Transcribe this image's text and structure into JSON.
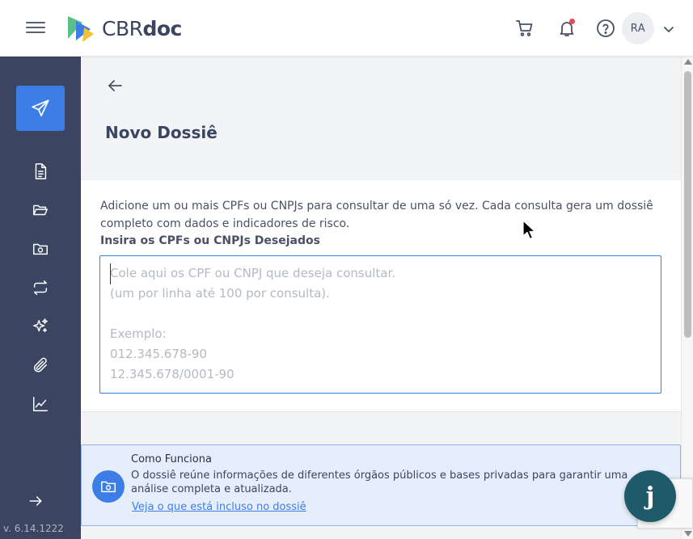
{
  "header": {
    "brand_cbr": "CBR",
    "brand_doc": "doc",
    "avatar_initials": "RA",
    "icons": [
      "menu-icon",
      "cart-icon",
      "bell-icon",
      "help-icon",
      "chevron-down-icon"
    ],
    "notification_dot_color": "#e24b58"
  },
  "sidebar": {
    "background": "#3b4561",
    "active_color": "#3d7ee6",
    "items": [
      {
        "icon": "send-icon",
        "active": true
      },
      {
        "icon": "document-icon"
      },
      {
        "icon": "folder-open-icon"
      },
      {
        "icon": "folder-camera-icon"
      },
      {
        "icon": "repeat-icon"
      },
      {
        "icon": "sparkles-icon"
      },
      {
        "icon": "paperclip-icon"
      },
      {
        "icon": "chart-line-icon"
      }
    ],
    "version": "v. 6.14.1222"
  },
  "main": {
    "title": "Novo Dossiê",
    "description": "Adicione um ou mais CPFs ou CNPJs para consultar de uma só vez. Cada consulta gera um dossiê completo com dados e indicadores de risco.",
    "field_label": "Insira os CPFs ou CNPJs Desejados",
    "textarea_value": "",
    "textarea_placeholder": "Cole aqui os CPF ou CNPJ que deseja consultar.\n(um por linha até 100 por consulta).\n\nExemplo:\n012.345.678-90\n12.345.678/0001-90"
  },
  "info": {
    "title": "Como Funciona",
    "text": "O dossiê reúne informações de diferentes órgãos públicos e bases privadas para garantir uma análise completa e atualizada.",
    "link": "Veja o que está incluso no dossiê",
    "icon": "folder-camera-icon"
  },
  "chat": {
    "label": "j"
  }
}
